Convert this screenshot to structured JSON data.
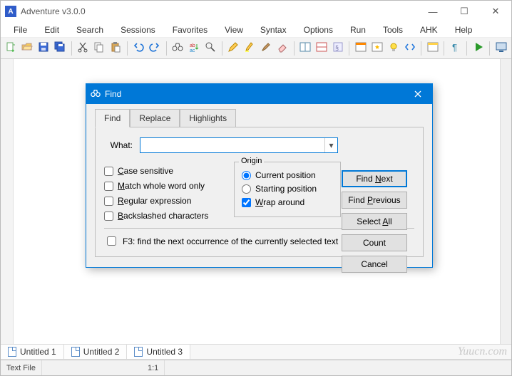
{
  "app": {
    "icon_letter": "A",
    "title": "Adventure v3.0.0",
    "winbtn_min": "—",
    "winbtn_max": "☐",
    "winbtn_close": "✕"
  },
  "menus": [
    "File",
    "Edit",
    "Search",
    "Sessions",
    "Favorites",
    "View",
    "Syntax",
    "Options",
    "Run",
    "Tools",
    "AHK",
    "Help"
  ],
  "toolbar_icons": [
    "new",
    "open",
    "save",
    "save-all",
    "|",
    "cut",
    "copy",
    "paste",
    "|",
    "undo",
    "redo",
    "|",
    "find",
    "replace",
    "search-files",
    "|",
    "pencil",
    "highlighter",
    "brush",
    "eraser",
    "|",
    "split-h",
    "ruler",
    "special",
    "|",
    "panel-app",
    "panel-star",
    "bulb",
    "code",
    "|",
    "panel-win",
    "|",
    "para",
    "|",
    "run",
    "|",
    "monitor"
  ],
  "doctabs": [
    {
      "label": "Untitled 1",
      "active": false
    },
    {
      "label": "Untitled 2",
      "active": false
    },
    {
      "label": "Untitled 3",
      "active": true
    }
  ],
  "status": {
    "left": "Text File",
    "pos": "1:1"
  },
  "find": {
    "title": "Find",
    "tabs": {
      "find": "Find",
      "replace": "Replace",
      "highlights": "Highlights"
    },
    "what_label": "What:",
    "what_value": "",
    "chk_case": "Case sensitive",
    "chk_whole": "Match whole word only",
    "chk_regex": "Regular expression",
    "chk_backslash": "Backslashed characters",
    "origin_legend": "Origin",
    "origin_current": "Current position",
    "origin_start": "Starting position",
    "chk_wrap": "Wrap around",
    "btn_next": "Find Next",
    "btn_prev": "Find Previous",
    "btn_selectall": "Select All",
    "btn_count": "Count",
    "btn_cancel": "Cancel",
    "f3": "F3: find the next occurrence of the currently selected text"
  },
  "watermark": "Yuucn.com"
}
